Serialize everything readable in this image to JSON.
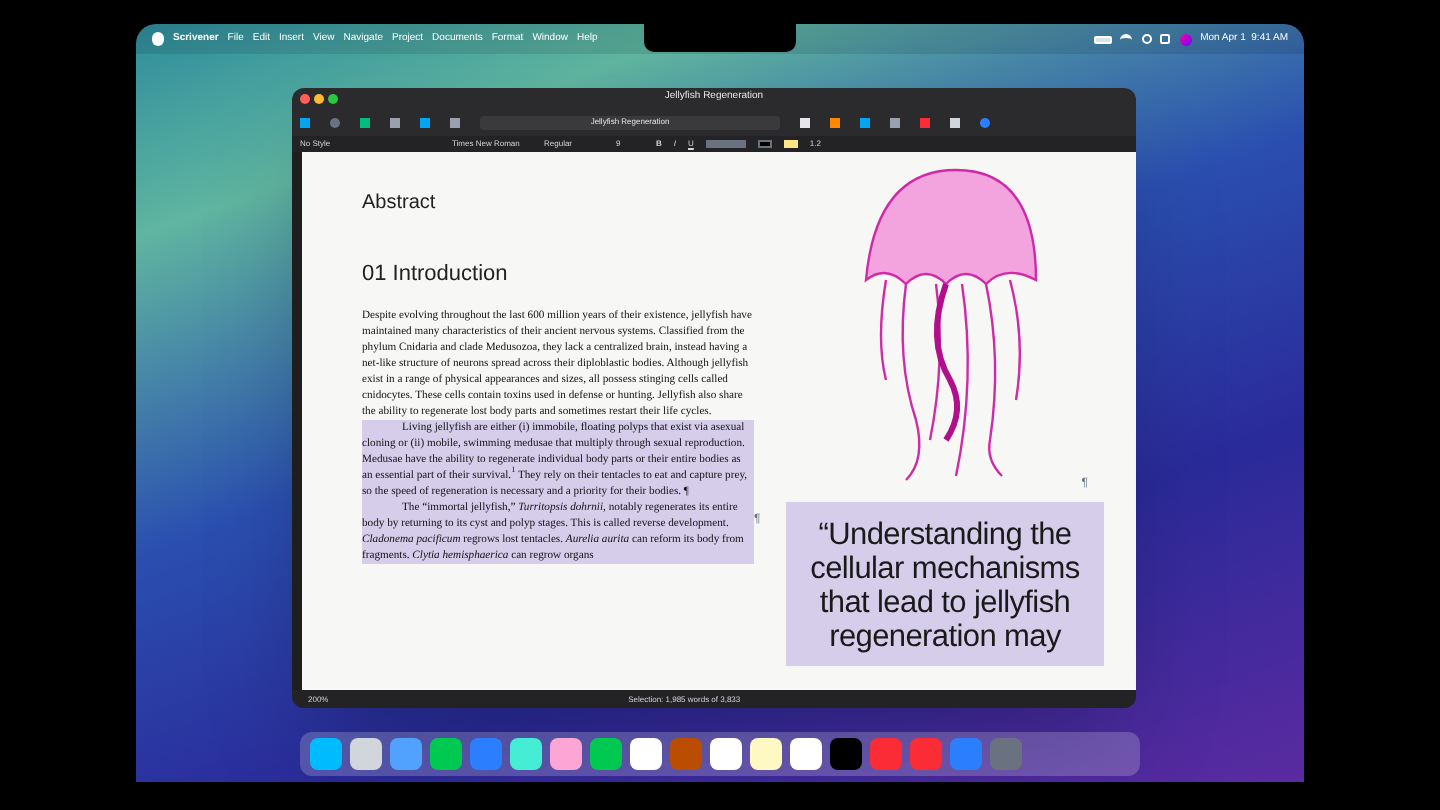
{
  "menu_bar": {
    "app": "Scrivener",
    "items": [
      "File",
      "Edit",
      "Insert",
      "View",
      "Navigate",
      "Project",
      "Documents",
      "Format",
      "Window",
      "Help"
    ],
    "clock": "Mon Apr 1  9:41 AM"
  },
  "window": {
    "title": "Jellyfish Regeneration",
    "toolbar_field": "Jellyfish Regeneration"
  },
  "format_bar": {
    "style": "No Style",
    "font": "Times New Roman",
    "weight": "Regular",
    "size": "9",
    "bold": "B",
    "italic": "I",
    "underline": "U",
    "line_spacing": "1.2"
  },
  "document": {
    "headings": [
      "Abstract",
      "01 Introduction"
    ],
    "paragraphs": [
      {
        "text": "Despite evolving throughout the last 600 million years of their existence, jellyfish have maintained many characteristics of their ancient nervous systems. Classified from the phylum Cnidaria and clade Medusozoa, they lack a centralized brain, instead having a net-like structure of neurons spread across their diploblastic bodies. Although jellyfish exist in a range of physical appearances and sizes, all possess stinging cells called cnidocytes. These cells contain toxins used in defense or hunting. Jellyfish also share the ability to regenerate lost body parts and sometimes restart their life cycles.",
        "selected": false,
        "indent": false
      },
      {
        "text": "Living jellyfish are either (i) immobile, floating polyps that exist via asexual cloning or (ii) mobile, swimming medusae that multiply through sexual reproduction. Medusae have the ability to regenerate individual body parts or their entire bodies as an essential part of their survival.$^{1}$ They rely on their tentacles to eat and capture prey, so the speed of regeneration is necessary and a priority for their bodies. ¶",
        "selected": true,
        "indent": true
      },
      {
        "text": "The “immortal jellyfish,” *Turritopsis dohrnii*, notably regenerates its entire body by returning to its cyst and polyp stages. This is called reverse development. *Cladonema pacificum* regrows lost tentacles. *Aurelia aurita* can reform its body from fragments. *Clytia hemisphaerica* can regrow organs",
        "selected": true,
        "indent": true
      }
    ],
    "pilcrows": [
      "¶",
      "¶"
    ],
    "pull_quote": {
      "text": "“Understanding the cellular mechanisms that lead to jellyfish regeneration may",
      "selected": true
    }
  },
  "status_bar": {
    "zoom": "200%",
    "selection": "Selection: 1,985 words of 3,833"
  }
}
